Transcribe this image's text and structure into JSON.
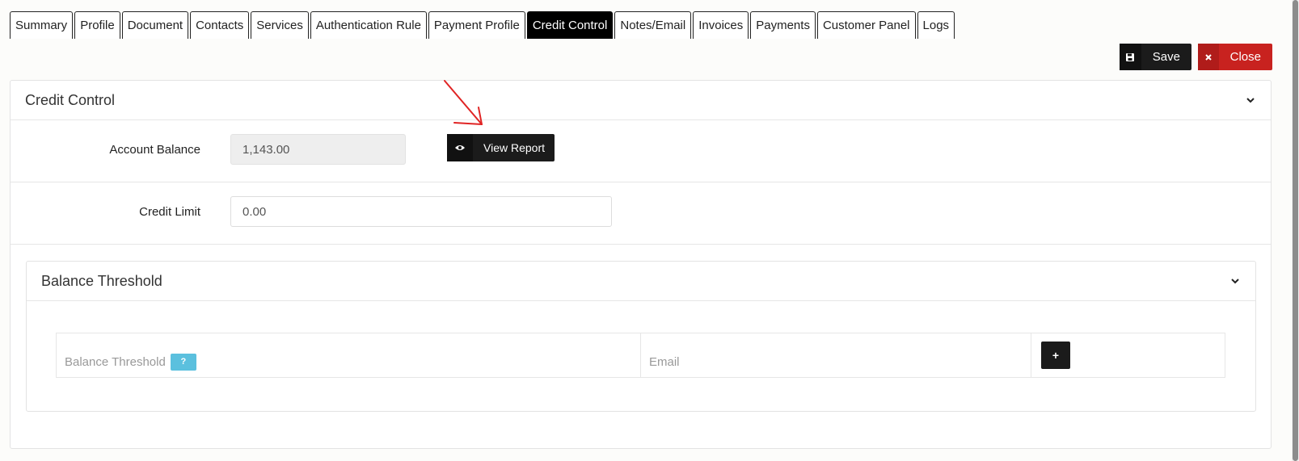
{
  "tabs": [
    {
      "label": "Summary",
      "active": false
    },
    {
      "label": "Profile",
      "active": false
    },
    {
      "label": "Document",
      "active": false
    },
    {
      "label": "Contacts",
      "active": false
    },
    {
      "label": "Services",
      "active": false
    },
    {
      "label": "Authentication Rule",
      "active": false
    },
    {
      "label": "Payment Profile",
      "active": false
    },
    {
      "label": "Credit Control",
      "active": true
    },
    {
      "label": "Notes/Email",
      "active": false
    },
    {
      "label": "Invoices",
      "active": false
    },
    {
      "label": "Payments",
      "active": false
    },
    {
      "label": "Customer Panel",
      "active": false
    },
    {
      "label": "Logs",
      "active": false
    }
  ],
  "toolbar": {
    "save_label": "Save",
    "close_label": "Close",
    "close_color": "#c8221f"
  },
  "credit_control": {
    "title": "Credit Control",
    "account_balance_label": "Account Balance",
    "account_balance_value": "1,143.00",
    "view_report_label": "View Report",
    "credit_limit_label": "Credit Limit",
    "credit_limit_value": "0.00"
  },
  "balance_threshold": {
    "title": "Balance Threshold",
    "col_threshold_placeholder": "Balance Threshold",
    "help_badge": "?",
    "col_email_placeholder": "Email",
    "add_label": "+",
    "help_color": "#5bc0de"
  },
  "annotation": {
    "arrow_color": "#e02424"
  }
}
